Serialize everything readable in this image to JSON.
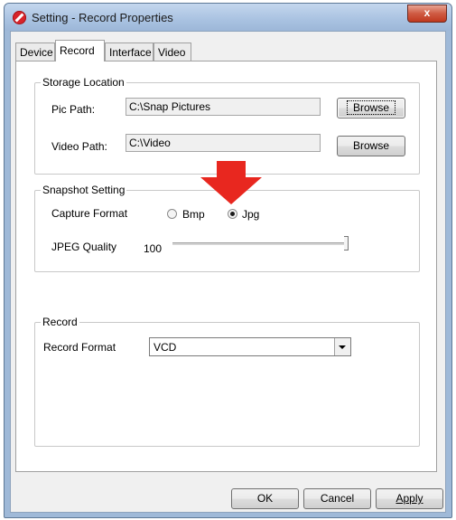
{
  "window": {
    "title": "Setting - Record Properties",
    "close_glyph": "x"
  },
  "tabs": [
    {
      "label": "Device",
      "active": false
    },
    {
      "label": "Record",
      "active": true
    },
    {
      "label": "Interface",
      "active": false
    },
    {
      "label": "Video",
      "active": false
    }
  ],
  "storage": {
    "title": "Storage Location",
    "pic_path_label": "Pic Path:",
    "pic_path_value": "C:\\Snap Pictures",
    "video_path_label": "Video Path:",
    "video_path_value": "C:\\Video",
    "browse_label": "Browse"
  },
  "snapshot": {
    "title": "Snapshot Setting",
    "capture_format_label": "Capture Format",
    "options": [
      {
        "label": "Bmp",
        "selected": false
      },
      {
        "label": "Jpg",
        "selected": true
      }
    ],
    "jpeg_quality_label": "JPEG Quality",
    "jpeg_quality_value": "100",
    "jpeg_quality_level": 1.0
  },
  "record": {
    "title": "Record",
    "record_format_label": "Record Format",
    "record_format_value": "VCD"
  },
  "footer": {
    "ok_label": "OK",
    "cancel_label": "Cancel",
    "apply_label": "Apply"
  },
  "colors": {
    "accent_arrow": "#e8271f",
    "title_bar": "#a9c2e1",
    "close_button": "#c9452e"
  },
  "icons": {
    "app": "record-app-icon",
    "close": "close-icon",
    "annotation": "red-down-arrow-icon"
  }
}
